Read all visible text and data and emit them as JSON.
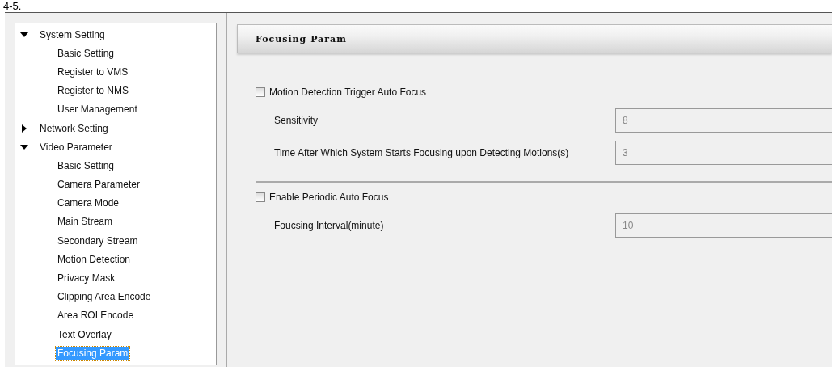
{
  "caption": "4-5.",
  "sidebar": {
    "items": [
      {
        "label": "System Setting",
        "expanded": true,
        "selected": false,
        "children": [
          {
            "label": "Basic Setting",
            "selected": false
          },
          {
            "label": "Register to VMS",
            "selected": false
          },
          {
            "label": "Register to NMS",
            "selected": false
          },
          {
            "label": "User Management",
            "selected": false
          }
        ]
      },
      {
        "label": "Network Setting",
        "expanded": false,
        "selected": false
      },
      {
        "label": "Video Parameter",
        "expanded": true,
        "selected": false,
        "children": [
          {
            "label": "Basic Setting",
            "selected": false
          },
          {
            "label": "Camera Parameter",
            "selected": false
          },
          {
            "label": "Camera Mode",
            "selected": false
          },
          {
            "label": "Main Stream",
            "selected": false
          },
          {
            "label": "Secondary Stream",
            "selected": false
          },
          {
            "label": "Motion Detection",
            "selected": false
          },
          {
            "label": "Privacy Mask",
            "selected": false
          },
          {
            "label": "Clipping Area Encode",
            "selected": false
          },
          {
            "label": "Area ROI Encode",
            "selected": false
          },
          {
            "label": "Text Overlay",
            "selected": false
          },
          {
            "label": "Focusing Param",
            "selected": true
          }
        ]
      }
    ]
  },
  "panel": {
    "title": "Focusing Param",
    "sections": [
      {
        "checkbox": {
          "label": "Motion Detection Trigger Auto Focus",
          "checked": false
        },
        "fields": [
          {
            "label": "Sensitivity",
            "value": "8",
            "disabled": true
          },
          {
            "label": "Time After Which System Starts Focusing upon Detecting Motions(s)",
            "value": "3",
            "disabled": true
          }
        ]
      },
      {
        "checkbox": {
          "label": "Enable Periodic Auto Focus",
          "checked": false
        },
        "fields": [
          {
            "label": "Foucsing Interval(minute)",
            "value": "10",
            "disabled": true
          }
        ]
      }
    ]
  }
}
